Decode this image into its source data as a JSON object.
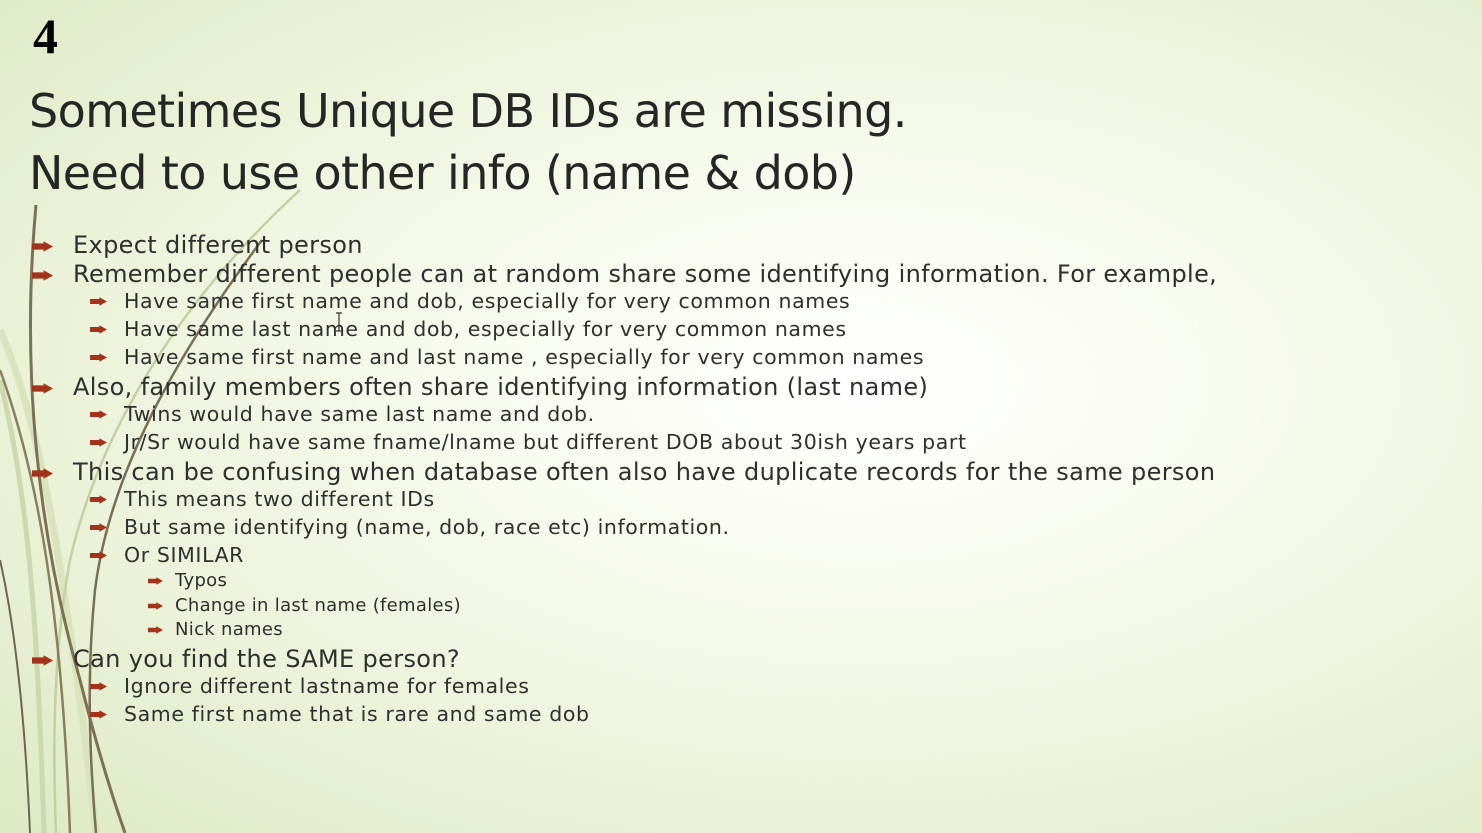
{
  "slide": {
    "number": "4",
    "title_lines": [
      "Sometimes Unique DB IDs are missing.",
      "Need to use other info (name & dob)"
    ],
    "bullet_icon": "arrow-bullet-icon",
    "accent_color": "#a5321b",
    "bullets": [
      {
        "level": 1,
        "text": "Expect different person"
      },
      {
        "level": 1,
        "text": "Remember different people can at random share some identifying information. For example,"
      },
      {
        "level": 2,
        "text": "Have same first name and dob, especially for very common names"
      },
      {
        "level": 2,
        "text": "Have same last name and dob, especially for very common names"
      },
      {
        "level": 2,
        "text": "Have same first name and last name , especially for very common names"
      },
      {
        "level": 1,
        "text": "Also, family members often share identifying information (last name)"
      },
      {
        "level": 2,
        "text": "Twins would have same last name and dob."
      },
      {
        "level": 2,
        "text": "Jr/Sr would have same fname/lname but different DOB about 30ish years part"
      },
      {
        "level": 1,
        "text": "This can be confusing when database often also have duplicate records for the same person"
      },
      {
        "level": 2,
        "text": "This means two different IDs"
      },
      {
        "level": 2,
        "text": "But same identifying (name, dob, race etc) information."
      },
      {
        "level": 2,
        "text": "Or SIMILAR"
      },
      {
        "level": 3,
        "text": "Typos"
      },
      {
        "level": 3,
        "text": "Change in last name (females)"
      },
      {
        "level": 3,
        "text": "Nick names"
      },
      {
        "level": 1,
        "text": "Can you find the SAME person?"
      },
      {
        "level": 2,
        "text": "Ignore different lastname for females"
      },
      {
        "level": 2,
        "text": "Same first name that is rare and same dob"
      }
    ]
  }
}
